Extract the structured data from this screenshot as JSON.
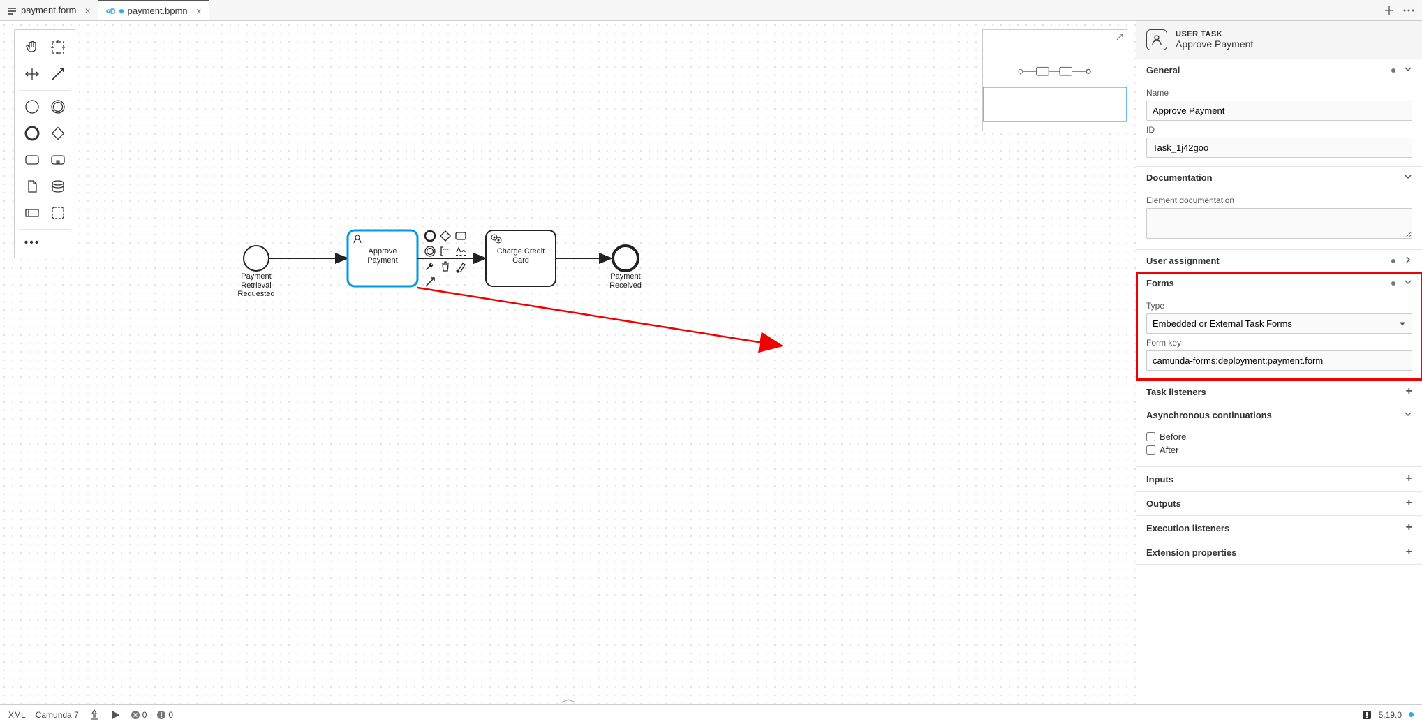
{
  "tabs": [
    {
      "label": "payment.form",
      "dirty": false
    },
    {
      "label": "payment.bpmn",
      "dirty": true
    }
  ],
  "diagram": {
    "nodes": {
      "start": {
        "label": "Payment\nRetrieval\nRequested"
      },
      "approve": {
        "label": "Approve Payment"
      },
      "charge": {
        "label": "Charge Credit Card"
      },
      "end": {
        "label": "Payment\nReceived"
      }
    }
  },
  "panel": {
    "type_label": "USER TASK",
    "name_label": "Approve Payment",
    "general": {
      "title": "General",
      "name_label": "Name",
      "name_value": "Approve Payment",
      "id_label": "ID",
      "id_value": "Task_1j42goo"
    },
    "documentation": {
      "title": "Documentation",
      "label": "Element documentation",
      "value": ""
    },
    "user_assignment": {
      "title": "User assignment"
    },
    "forms": {
      "title": "Forms",
      "type_label": "Type",
      "type_value": "Embedded or External Task Forms",
      "key_label": "Form key",
      "key_value": "camunda-forms:deployment:payment.form"
    },
    "task_listeners": {
      "title": "Task listeners"
    },
    "async": {
      "title": "Asynchronous continuations",
      "before": "Before",
      "after": "After"
    },
    "inputs": {
      "title": "Inputs"
    },
    "outputs": {
      "title": "Outputs"
    },
    "execution_listeners": {
      "title": "Execution listeners"
    },
    "extension_properties": {
      "title": "Extension properties"
    }
  },
  "status_bar": {
    "xml": "XML",
    "platform": "Camunda 7",
    "errors": "0",
    "warnings": "0",
    "version": "5.19.0"
  }
}
